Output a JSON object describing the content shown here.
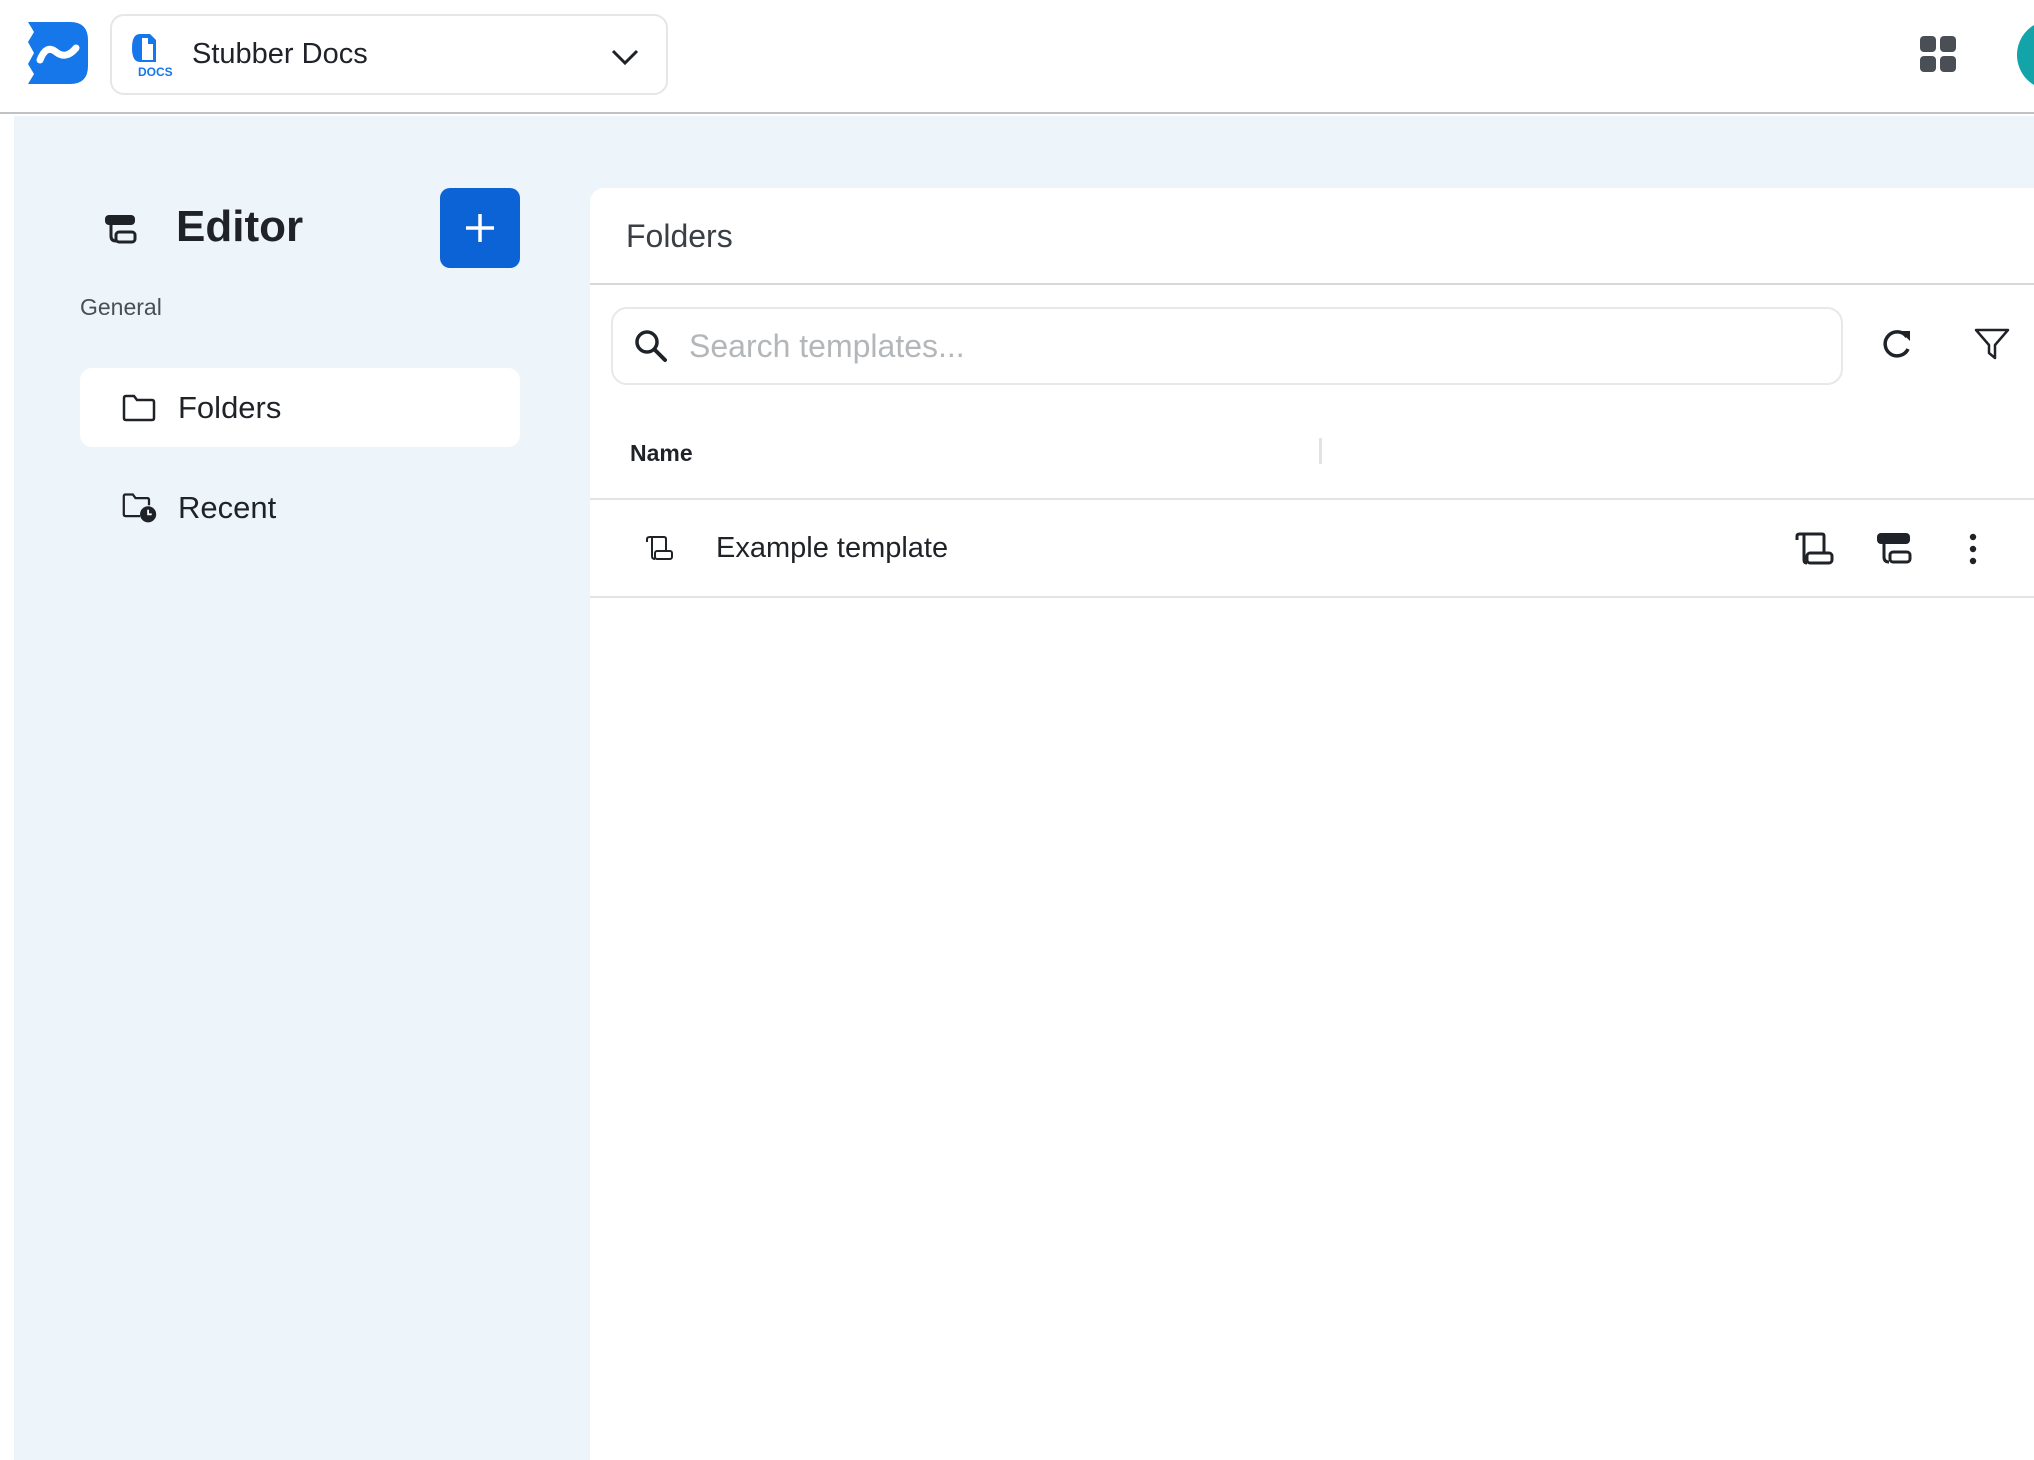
{
  "header": {
    "app_name": "Stubber Docs",
    "app_icon_text": "DOCS",
    "brand_color": "#0b63d6",
    "avatar_color": "#12a4a8"
  },
  "sidebar": {
    "title": "Editor",
    "section": "General",
    "items": [
      {
        "label": "Folders",
        "icon": "folder-icon",
        "active": true
      },
      {
        "label": "Recent",
        "icon": "folder-clock-icon",
        "active": false
      }
    ]
  },
  "main": {
    "title": "Folders",
    "search": {
      "placeholder": "Search templates...",
      "value": ""
    },
    "columns": [
      "Name"
    ],
    "rows": [
      {
        "name": "Example template",
        "icon": "scroll-icon"
      }
    ]
  }
}
